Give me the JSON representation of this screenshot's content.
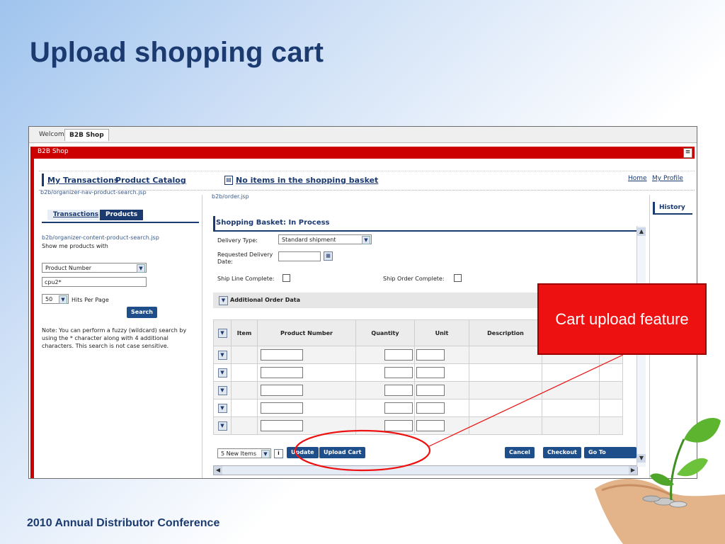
{
  "slide": {
    "title": "Upload shopping cart",
    "footer": "2010 Annual Distributor Conference"
  },
  "portal": {
    "tabs": [
      "Welcome",
      "B2B Shop"
    ],
    "active_tab": "B2B Shop",
    "red_bar_title": "B2B Shop",
    "nav": {
      "my_transactions": "My Transactions",
      "product_catalog": "Product Catalog",
      "basket_status": "No items in the shopping basket",
      "home": "Home",
      "my_profile": "My Profile"
    }
  },
  "left_panel": {
    "path1": "b2b/organizer-nav-product-search.jsp",
    "tabs": [
      "Transactions",
      "Products"
    ],
    "path2": "b2b/organizer-content-product-search.jsp",
    "show_products_label": "Show me products with",
    "search_type": "Product Number",
    "search_value": "cpu2*",
    "hits_value": "50",
    "hits_label": "Hits Per Page",
    "search_button": "Search",
    "note": "Note: You can perform a fuzzy (wildcard) search by using the * character along with 4 additional characters. This search is not case sensitive."
  },
  "main_panel": {
    "path": "b2b/order.jsp",
    "basket_title": "Shopping Basket: In Process",
    "delivery_type_label": "Delivery Type:",
    "delivery_type_value": "Standard shipment",
    "requested_delivery_label1": "Requested Delivery",
    "requested_delivery_label2": "Date:",
    "ship_line_label": "Ship Line Complete:",
    "ship_order_label": "Ship Order Complete:",
    "additional_order_label": "Additional Order Data",
    "table_headers": [
      "Item",
      "Product Number",
      "Quantity",
      "Unit",
      "Description"
    ],
    "empty_rows": 5,
    "new_items_value": "5 New Items",
    "buttons": {
      "update": "Update",
      "upload_cart": "Upload Cart",
      "cancel": "Cancel",
      "checkout": "Checkout",
      "go_to_template": "Go To Template"
    }
  },
  "right_panel": {
    "history": "History"
  },
  "callout": {
    "text": "Cart upload feature",
    "color": "#ee1111"
  },
  "icons": [
    "menu-icon",
    "basket-icon",
    "dropdown-arrow-icon",
    "calendar-icon",
    "info-icon",
    "scroll-left-icon",
    "scroll-right-icon",
    "scroll-up-icon",
    "scroll-down-icon",
    "plant-hand-illustration"
  ]
}
